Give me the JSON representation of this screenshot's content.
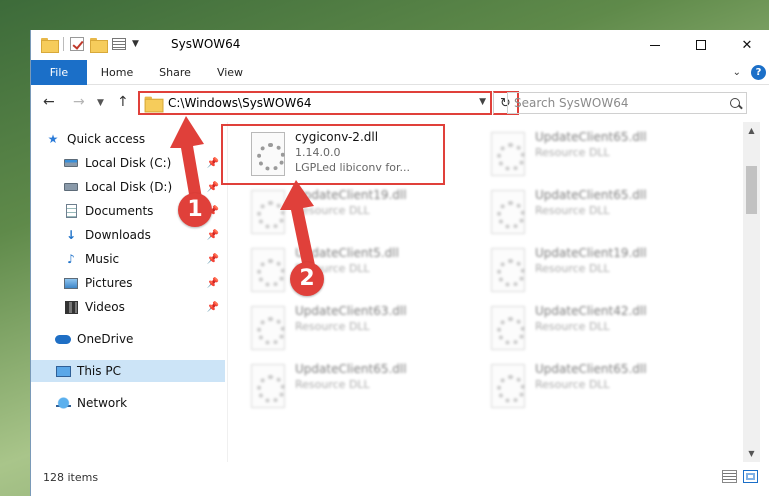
{
  "window": {
    "title": "SysWOW64",
    "colors": {
      "accent": "#1b6fc8",
      "annotation": "#e0403a",
      "selection": "#cce4f7"
    }
  },
  "window_controls": {
    "minimize": "—",
    "maximize": "☐",
    "close": "✕"
  },
  "ribbon": {
    "tabs": [
      "File",
      "Home",
      "Share",
      "View"
    ],
    "help": "?"
  },
  "nav": {
    "back": "←",
    "forward": "→",
    "up": "↑",
    "address": "C:\\Windows\\SysWOW64",
    "search_placeholder": "Search SysWOW64"
  },
  "sidebar": {
    "items": [
      {
        "label": "Quick access",
        "icon": "star-icon"
      },
      {
        "label": "Local Disk (C:)",
        "icon": "drive-icon",
        "pinned": true
      },
      {
        "label": "Local Disk (D:)",
        "icon": "drive-icon",
        "pinned": true
      },
      {
        "label": "Documents",
        "icon": "documents-icon",
        "pinned": true
      },
      {
        "label": "Downloads",
        "icon": "download-icon",
        "pinned": true
      },
      {
        "label": "Music",
        "icon": "music-icon",
        "pinned": true
      },
      {
        "label": "Pictures",
        "icon": "pictures-icon",
        "pinned": true
      },
      {
        "label": "Videos",
        "icon": "videos-icon",
        "pinned": true
      },
      {
        "label": "OneDrive",
        "icon": "cloud-icon"
      },
      {
        "label": "This PC",
        "icon": "computer-icon",
        "selected": true
      },
      {
        "label": "Network",
        "icon": "network-icon"
      }
    ]
  },
  "files": {
    "highlighted": {
      "name": "cygiconv-2.dll",
      "version": "1.14.0.0",
      "description": "LGPLed libiconv for..."
    },
    "tiles": [
      {
        "name": "UpdateClient65.dll",
        "sub": "Resource DLL"
      },
      {
        "name": "UpdateClient19.dll",
        "sub": "Resource DLL"
      },
      {
        "name": "UpdateClient65.dll",
        "sub": "Resource DLL"
      },
      {
        "name": "UpdateClient5.dll",
        "sub": "Resource DLL"
      },
      {
        "name": "UpdateClient19.dll",
        "sub": "Resource DLL"
      },
      {
        "name": "UpdateClient63.dll",
        "sub": "Resource DLL"
      },
      {
        "name": "UpdateClient42.dll",
        "sub": "Resource DLL"
      },
      {
        "name": "UpdateClient65.dll",
        "sub": "Resource DLL"
      },
      {
        "name": "UpdateClient65.dll",
        "sub": "Resource DLL"
      }
    ]
  },
  "status": {
    "item_count": "128 items"
  },
  "callouts": {
    "one": "1",
    "two": "2"
  }
}
